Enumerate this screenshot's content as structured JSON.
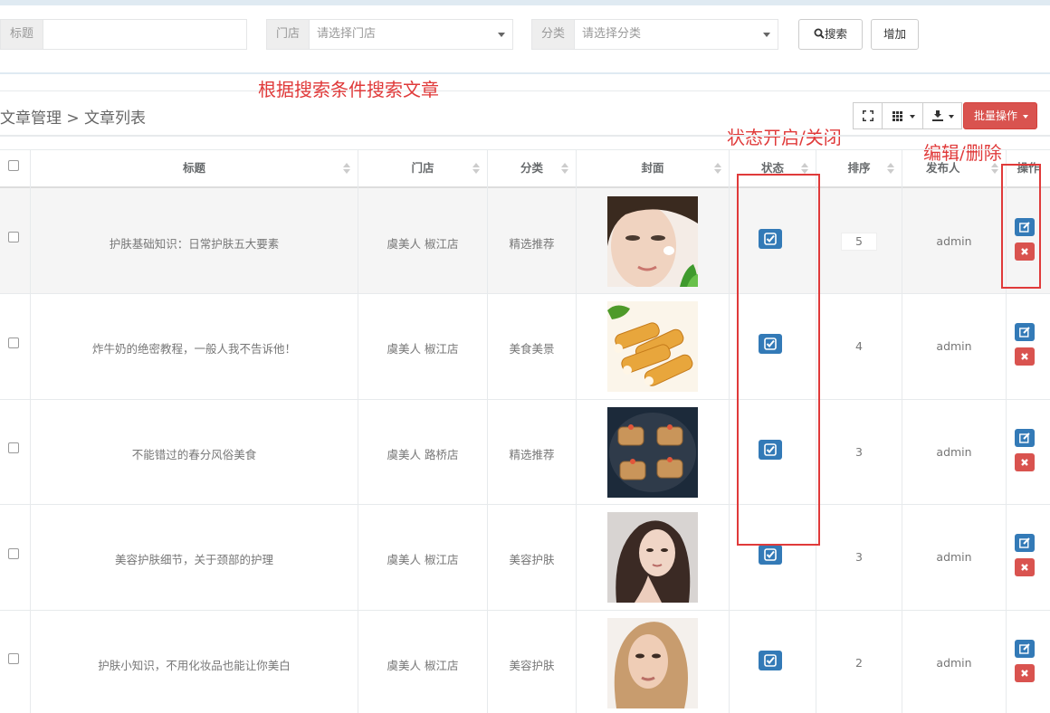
{
  "search": {
    "title_label": "标题",
    "title_value": "",
    "store_label": "门店",
    "store_placeholder": "请选择门店",
    "category_label": "分类",
    "category_placeholder": "请选择分类",
    "search_button": "搜索",
    "add_button": "增加"
  },
  "annotations": {
    "search_hint": "根据搜索条件搜索文章",
    "status_hint": "状态开启/关闭",
    "action_hint": "编辑/删除"
  },
  "breadcrumb": "文章管理 > 文章列表",
  "toolbar": {
    "batch_label": "批量操作"
  },
  "table": {
    "headers": {
      "title": "标题",
      "store": "门店",
      "category": "分类",
      "cover": "封面",
      "status": "状态",
      "sort": "排序",
      "publisher": "发布人",
      "actions": "操作"
    },
    "rows": [
      {
        "title": "护肤基础知识：日常护肤五大要素",
        "store": "虞美人 椒江店",
        "category": "精选推荐",
        "cover": "face-woman",
        "status": "on",
        "sort": "5",
        "publisher": "admin"
      },
      {
        "title": "炸牛奶的绝密教程，一般人我不告诉他！",
        "store": "虞美人 椒江店",
        "category": "美食美景",
        "cover": "fried-rolls",
        "status": "on",
        "sort": "4",
        "publisher": "admin"
      },
      {
        "title": "不能错过的春分风俗美食",
        "store": "虞美人 路桥店",
        "category": "精选推荐",
        "cover": "dumplings-plate",
        "status": "on",
        "sort": "3",
        "publisher": "admin"
      },
      {
        "title": "美容护肤细节，关于颈部的护理",
        "store": "虞美人 椒江店",
        "category": "美容护肤",
        "cover": "woman-dark-hair",
        "status": "on",
        "sort": "3",
        "publisher": "admin"
      },
      {
        "title": "护肤小知识，不用化妆品也能让你美白",
        "store": "虞美人 椒江店",
        "category": "美容护肤",
        "cover": "woman-blonde",
        "status": "on",
        "sort": "2",
        "publisher": "admin"
      }
    ]
  },
  "colors": {
    "primary": "#337ab7",
    "danger": "#d9534f",
    "annotation": "#e03a3a"
  }
}
